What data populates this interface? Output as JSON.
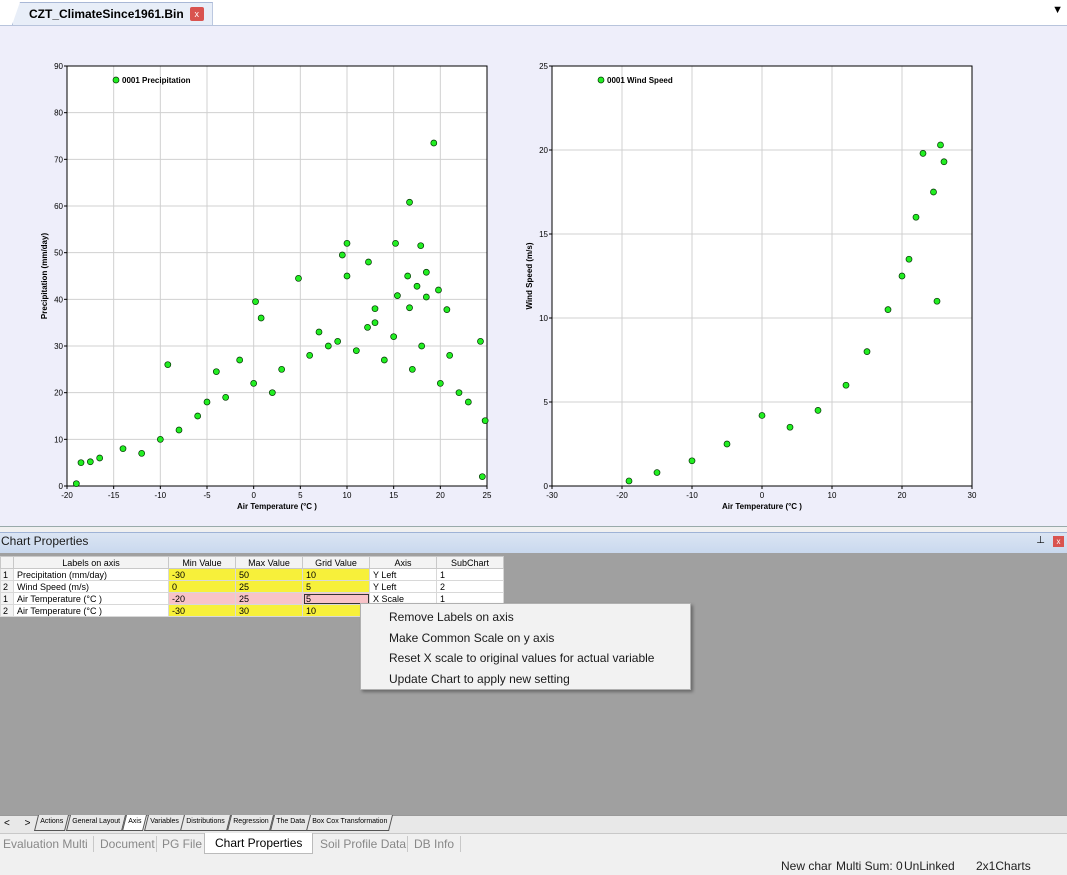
{
  "document_tab": {
    "title": "CZT_ClimateSince1961.Bin",
    "close_glyph": "x",
    "menu_glyph": "▼"
  },
  "chart_data": [
    {
      "type": "scatter",
      "xlabel": "Air Temperature    (°C    )",
      "ylabel": "Precipitation (mm/day)",
      "legend": "0001 Precipitation",
      "legend_position": "top-left",
      "xlim": [
        -20,
        25
      ],
      "ylim": [
        0,
        90
      ],
      "xticks": [
        -20,
        -15,
        -10,
        -5,
        0,
        5,
        10,
        15,
        20,
        25
      ],
      "yticks": [
        0,
        10,
        20,
        30,
        40,
        50,
        60,
        70,
        80,
        90
      ],
      "grid": true,
      "marker_color": "#22ee22",
      "points": [
        [
          19.3,
          73.5
        ],
        [
          16.7,
          60.8
        ],
        [
          17.9,
          51.5
        ],
        [
          15.2,
          52
        ],
        [
          10,
          52
        ],
        [
          9.5,
          49.5
        ],
        [
          12.3,
          48
        ],
        [
          10,
          45
        ],
        [
          4.8,
          44.5
        ],
        [
          16.5,
          45
        ],
        [
          18.5,
          45.8
        ],
        [
          17.5,
          42.8
        ],
        [
          19.8,
          42
        ],
        [
          18.5,
          40.5
        ],
        [
          15.4,
          40.8
        ],
        [
          0.2,
          39.5
        ],
        [
          0.8,
          36
        ],
        [
          13,
          38
        ],
        [
          16.7,
          38.2
        ],
        [
          20.7,
          37.8
        ],
        [
          12.2,
          34
        ],
        [
          24.3,
          31
        ],
        [
          -9.2,
          26
        ],
        [
          -4,
          24.5
        ],
        [
          -1.5,
          27
        ],
        [
          -14,
          8
        ],
        [
          -18.5,
          5
        ],
        [
          -17.5,
          5.2
        ],
        [
          -16.5,
          6
        ],
        [
          -12,
          7
        ],
        [
          -10,
          10
        ],
        [
          -8,
          12
        ],
        [
          -6,
          15
        ],
        [
          -3,
          19
        ],
        [
          0,
          22
        ],
        [
          3,
          25
        ],
        [
          6,
          28
        ],
        [
          8,
          30
        ],
        [
          11,
          29
        ],
        [
          14,
          27
        ],
        [
          17,
          25
        ],
        [
          20,
          22
        ],
        [
          23,
          18
        ],
        [
          24.8,
          14
        ],
        [
          -5,
          18
        ],
        [
          2,
          20
        ],
        [
          7,
          33
        ],
        [
          9,
          31
        ],
        [
          13,
          35
        ],
        [
          15,
          32
        ],
        [
          18,
          30
        ],
        [
          21,
          28
        ],
        [
          22,
          20
        ],
        [
          -19,
          0.5
        ],
        [
          24.5,
          2
        ]
      ]
    },
    {
      "type": "scatter",
      "xlabel": "Air Temperature    (°C    )",
      "ylabel": "Wind Speed (m/s)",
      "legend": "0001 Wind Speed",
      "legend_position": "top-left",
      "xlim": [
        -30,
        30
      ],
      "ylim": [
        0,
        25
      ],
      "xticks": [
        -30,
        -20,
        -10,
        0,
        10,
        20,
        30
      ],
      "yticks": [
        0,
        5,
        10,
        15,
        20,
        25
      ],
      "grid": true,
      "marker_color": "#22ee22",
      "points": [
        [
          25.5,
          20.3
        ],
        [
          23,
          19.8
        ],
        [
          26,
          19.3
        ],
        [
          24.5,
          17.5
        ],
        [
          22,
          16
        ],
        [
          25,
          11
        ],
        [
          21,
          13.5
        ],
        [
          20,
          12.5
        ],
        [
          18,
          10.5
        ],
        [
          15,
          8
        ],
        [
          12,
          6
        ],
        [
          8,
          4.5
        ],
        [
          4,
          3.5
        ],
        [
          0,
          4.2
        ],
        [
          -5,
          2.5
        ],
        [
          -10,
          1.5
        ],
        [
          -15,
          0.8
        ],
        [
          -19,
          0.3
        ]
      ]
    }
  ],
  "panel": {
    "title": "Chart Properties",
    "pin_glyph": "⊥",
    "close_glyph": "x"
  },
  "table": {
    "headers": [
      "Labels on axis",
      "Min Value",
      "Max Value",
      "Grid Value",
      "Axis",
      "SubChart"
    ],
    "rows": [
      {
        "n": "1",
        "label": "Precipitation (mm/day)",
        "min": "-30",
        "max": "50",
        "grid": "10",
        "axis": "Y Left",
        "sub": "1"
      },
      {
        "n": "2",
        "label": "Wind Speed (m/s)",
        "min": "0",
        "max": "25",
        "grid": "5",
        "axis": "Y Left",
        "sub": "2"
      },
      {
        "n": "1",
        "label": "Air Temperature     (°C     )",
        "min": "-20",
        "max": "25",
        "grid": "5",
        "axis": "X Scale",
        "sub": "1"
      },
      {
        "n": "2",
        "label": "Air Temperature     (°C     )",
        "min": "-30",
        "max": "30",
        "grid": "10",
        "axis": "",
        "sub": ""
      }
    ]
  },
  "context_menu": {
    "items": [
      "Remove Labels on axis",
      "Make Common Scale on y axis",
      "Reset X scale to original values for actual variable",
      "Update Chart to apply new setting"
    ]
  },
  "sheet_tabs": {
    "nav": "< >",
    "items": [
      "Actions",
      "General Layout",
      "Axis",
      "Variables",
      "Distributions",
      "Regression",
      "The Data",
      "Box Cox Transformation"
    ],
    "active": "Axis"
  },
  "bottom_tabs": {
    "items": [
      "Evaluation Multi",
      "Document",
      "PG File",
      "Chart Properties",
      "Soil Profile Data",
      "DB Info"
    ],
    "active": "Chart Properties"
  },
  "status": {
    "chart": "New char",
    "sum": "Multi Sum: 0",
    "link": "UnLinked",
    "layout": "2x1Charts"
  }
}
